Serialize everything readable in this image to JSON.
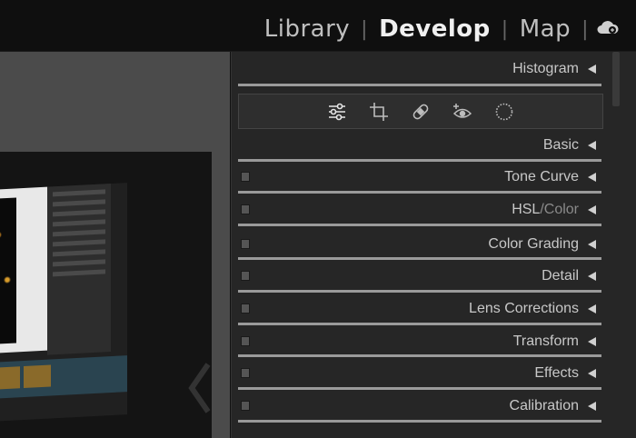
{
  "modules": {
    "library": "Library",
    "develop": "Develop",
    "map": "Map",
    "separator": "|",
    "active": "Develop"
  },
  "cloud_icon": "cloud-sync-icon",
  "panel": {
    "histogram": "Histogram",
    "tools": [
      "edit-sliders-icon",
      "crop-icon",
      "healing-icon",
      "red-eye-icon",
      "masking-icon"
    ],
    "sections": {
      "basic": "Basic",
      "tone_curve": "Tone Curve",
      "hsl": "HSL",
      "hsl_sep": "/",
      "color": "Color",
      "color_grading": "Color Grading",
      "detail": "Detail",
      "lens_corrections": "Lens Corrections",
      "transform": "Transform",
      "effects": "Effects",
      "calibration": "Calibration"
    }
  },
  "colors": {
    "panel_bg": "#262626",
    "header_text": "#c8c8c8",
    "active_module": "#f0f0f0"
  }
}
